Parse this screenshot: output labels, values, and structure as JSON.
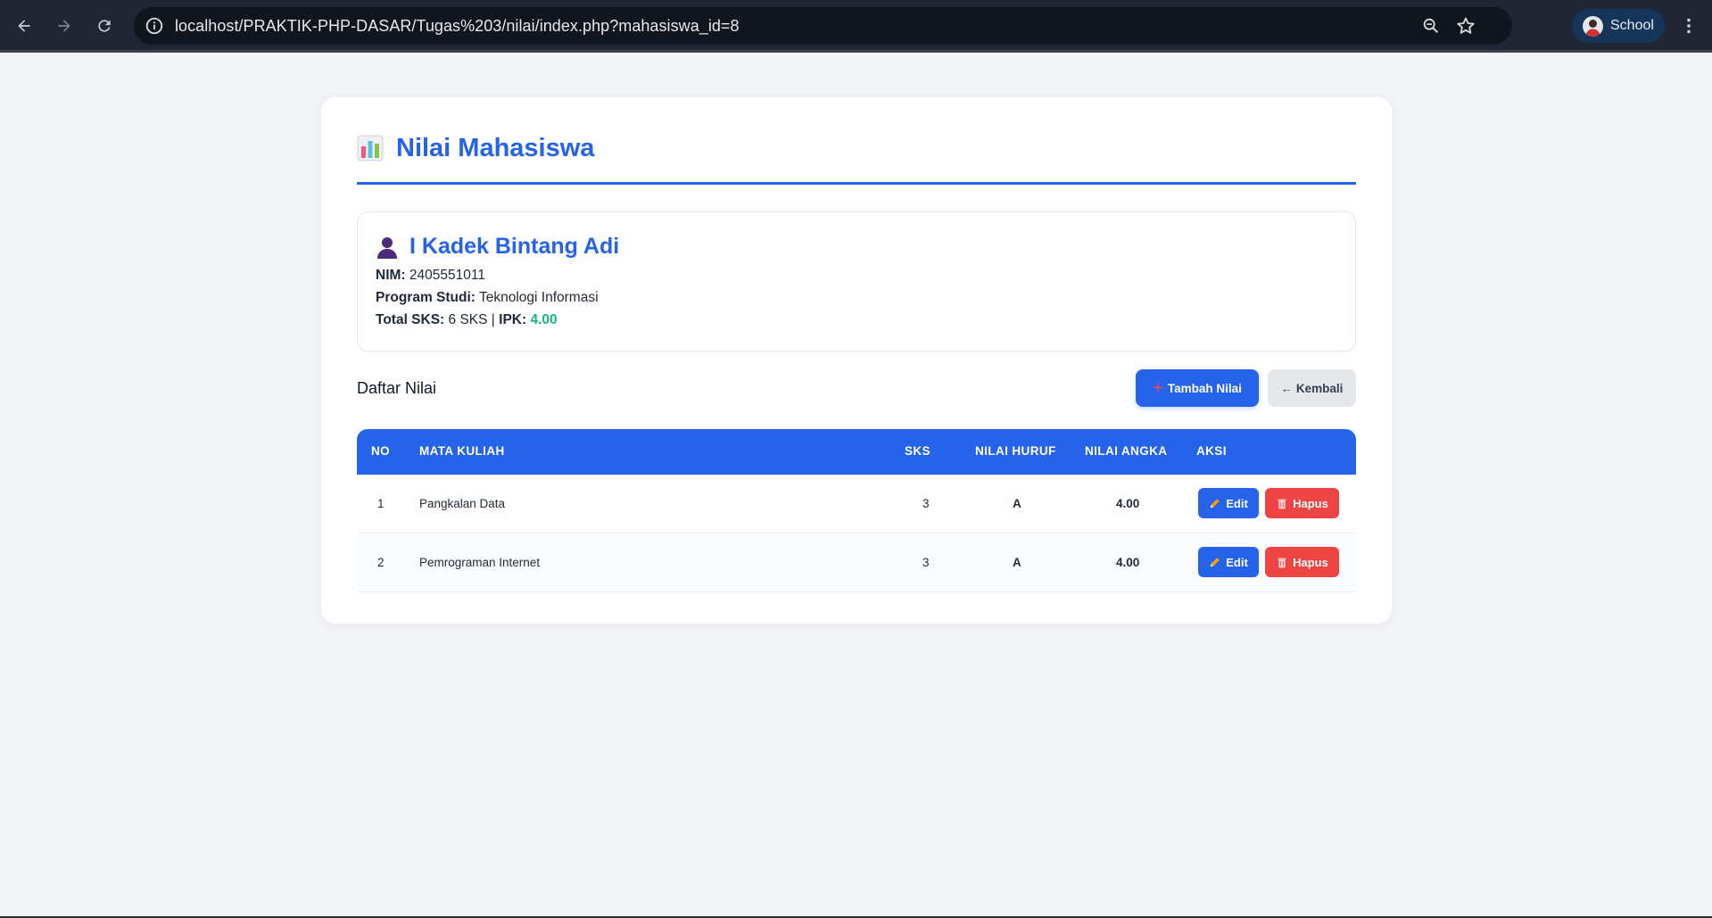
{
  "browser": {
    "url": "localhost/PRAKTIK-PHP-DASAR/Tugas%203/nilai/index.php?mahasiswa_id=8",
    "profile_label": "School"
  },
  "page": {
    "title": "Nilai Mahasiswa"
  },
  "student": {
    "name": "I Kadek Bintang Adi",
    "nim_label": "NIM:",
    "nim": "2405551011",
    "prodi_label": "Program Studi:",
    "prodi": "Teknologi Informasi",
    "total_sks_label": "Total SKS:",
    "total_sks": "6 SKS",
    "separator": "|",
    "ipk_label": "IPK:",
    "ipk": "4.00"
  },
  "list": {
    "title": "Daftar Nilai",
    "add_label": "Tambah Nilai",
    "add_icon": "+",
    "back_label": "← Kembali"
  },
  "table": {
    "headers": [
      "NO",
      "MATA KULIAH",
      "SKS",
      "NILAI HURUF",
      "NILAI ANGKA",
      "AKSI"
    ],
    "rows": [
      {
        "no": "1",
        "mata_kuliah": "Pangkalan Data",
        "sks": "3",
        "huruf": "A",
        "angka": "4.00"
      },
      {
        "no": "2",
        "mata_kuliah": "Pemrograman Internet",
        "sks": "3",
        "huruf": "A",
        "angka": "4.00"
      }
    ],
    "edit_label": "Edit",
    "hapus_label": "Hapus"
  },
  "colors": {
    "accent": "#2563eb",
    "danger": "#ef4444",
    "success": "#10b981"
  }
}
